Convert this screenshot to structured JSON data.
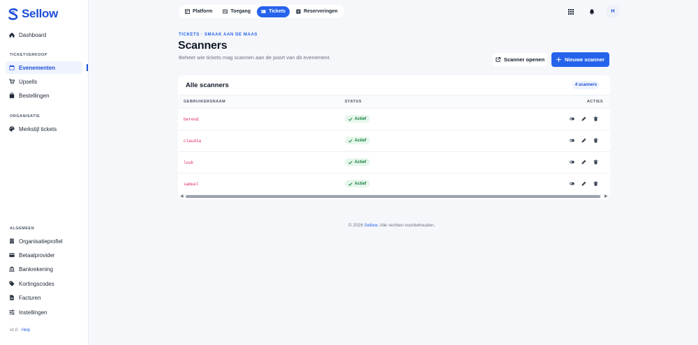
{
  "brand": {
    "name": "Sellow",
    "color": "#1d4ed8"
  },
  "sidebar": {
    "top_items": [
      {
        "label": "Dashboard",
        "icon": "home-icon"
      }
    ],
    "sections": [
      {
        "label": "TICKETVERKOOP",
        "items": [
          {
            "label": "Evenementen",
            "icon": "calendar-icon",
            "active": true
          },
          {
            "label": "Upsells",
            "icon": "cart-icon"
          },
          {
            "label": "Bestellingen",
            "icon": "bag-icon"
          }
        ]
      },
      {
        "label": "ORGANISATIE",
        "items": [
          {
            "label": "Merkstijl tickets",
            "icon": "palette-icon"
          }
        ]
      },
      {
        "label": "ALGEMEEN",
        "items": [
          {
            "label": "Organisatieprofiel",
            "icon": "building-icon"
          },
          {
            "label": "Betaalprovider",
            "icon": "credit-card-icon"
          },
          {
            "label": "Bankrekening",
            "icon": "bank-icon"
          },
          {
            "label": "Kortingscodes",
            "icon": "tag-icon"
          },
          {
            "label": "Facturen",
            "icon": "document-icon"
          },
          {
            "label": "Instellingen",
            "icon": "sliders-icon"
          }
        ]
      }
    ],
    "version": "v1.0",
    "separator": "·",
    "help": "Help"
  },
  "tabs": [
    {
      "label": "Platform",
      "icon": "layout-icon"
    },
    {
      "label": "Toegang",
      "icon": "id-card-icon"
    },
    {
      "label": "Tickets",
      "icon": "ticket-icon",
      "active": true
    },
    {
      "label": "Reserveringen",
      "icon": "table-icon"
    }
  ],
  "top_icons": {
    "apps": "grid-icon",
    "notifications": "bell-icon",
    "avatar_initial": "H"
  },
  "header": {
    "breadcrumb": "TICKETS · SMAAK AAN DE MAAS",
    "title": "Scanners",
    "subtitle": "Beheer wie tickets mag scannen aan de poort van dit evenement.",
    "open_button": "Scanner openen",
    "new_button": "Nieuwe scanner"
  },
  "card": {
    "title": "Alle scanners",
    "count": "4 scanners",
    "columns": {
      "username": "GEBRUIKERSNAAM",
      "status": "STATUS",
      "actions": "ACTIES"
    },
    "rows": [
      {
        "username": "berend",
        "status": "Actief"
      },
      {
        "username": "claudia",
        "status": "Actief"
      },
      {
        "username": "luuk",
        "status": "Actief"
      },
      {
        "username": "samuel",
        "status": "Actief"
      }
    ]
  },
  "footer": {
    "prefix": "© 2026",
    "brand": "Sellow",
    "suffix": ". Alle rechten voorbehouden."
  },
  "colors": {
    "accent": "#2563eb",
    "success_bg": "#e7f6ec",
    "success_text": "#15803d",
    "username": "#e0245e"
  }
}
